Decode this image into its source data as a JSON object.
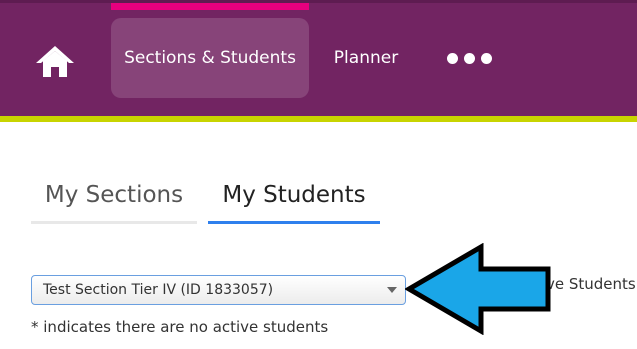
{
  "nav": {
    "home_icon": "home-icon",
    "items": [
      {
        "label": "Sections & Students",
        "active": true
      },
      {
        "label": "Planner",
        "active": false
      }
    ],
    "more_icon": "more-dots-icon"
  },
  "colors": {
    "nav_background": "#722462",
    "nav_active_indicator": "#e6007e",
    "accent_bar": "#c8d400",
    "active_tab_underline": "#2f80ed",
    "callout_arrow": "#1aa6e8"
  },
  "tabs": [
    {
      "label": "My Sections",
      "active": false
    },
    {
      "label": "My Students",
      "active": true
    }
  ],
  "section_select": {
    "selected_value": "Test Section Tier IV (ID 1833057)"
  },
  "partial_label": "ve Students",
  "note": "* indicates there are no active students",
  "annotation": {
    "icon": "callout-arrow-icon",
    "points": "left"
  }
}
